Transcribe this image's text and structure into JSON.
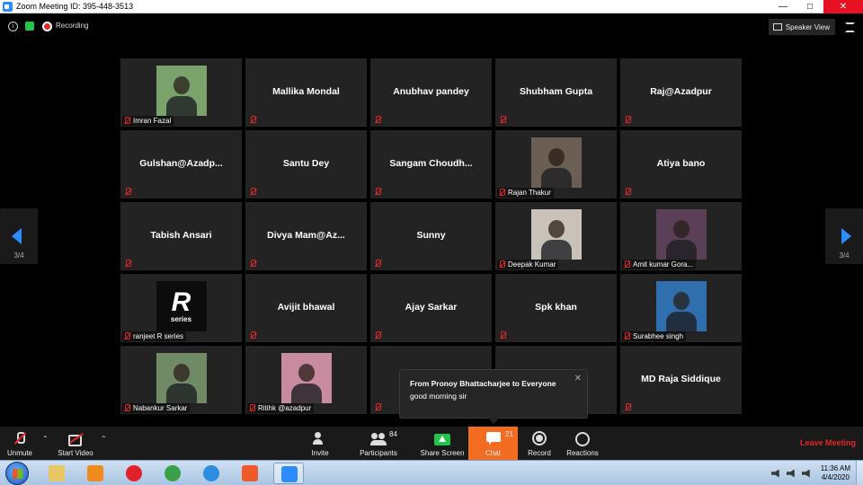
{
  "window": {
    "title": "Zoom Meeting ID: 395-448-3513"
  },
  "topbar": {
    "recording_label": "Recording",
    "speaker_view_label": "Speaker View"
  },
  "page_nav": {
    "indicator": "3/4"
  },
  "tiles": [
    {
      "display": "photo",
      "label": "Imran Fazal",
      "name": "",
      "photo_color": "#7aa36b"
    },
    {
      "display": "name",
      "name": "Mallika Mondal",
      "label": ""
    },
    {
      "display": "name",
      "name": "Anubhav pandey",
      "label": ""
    },
    {
      "display": "name",
      "name": "Shubham Gupta",
      "label": ""
    },
    {
      "display": "name",
      "name": "Raj@Azadpur",
      "label": ""
    },
    {
      "display": "name",
      "name": "Gulshan@Azadp...",
      "label": ""
    },
    {
      "display": "name",
      "name": "Santu Dey",
      "label": ""
    },
    {
      "display": "name",
      "name": "Sangam  Choudh...",
      "label": ""
    },
    {
      "display": "photo",
      "label": "Rajan Thakur",
      "name": "",
      "photo_color": "#6b5e52"
    },
    {
      "display": "name",
      "name": "Atiya bano",
      "label": ""
    },
    {
      "display": "name",
      "name": "Tabish Ansari",
      "label": ""
    },
    {
      "display": "name",
      "name": "Divya  Mam@Az...",
      "label": ""
    },
    {
      "display": "name",
      "name": "Sunny",
      "label": ""
    },
    {
      "display": "photo",
      "label": "Deepak Kumar",
      "name": "",
      "photo_color": "#c9c2b8"
    },
    {
      "display": "photo",
      "label": "Amit kumar Gora...",
      "name": "",
      "photo_color": "#5a3f57"
    },
    {
      "display": "photo",
      "label": "ranjeet R series",
      "name": "",
      "photo_color": "#0c0c0c",
      "logo_text": "R",
      "logo_sub": "series"
    },
    {
      "display": "name",
      "name": "Avijit bhawal",
      "label": ""
    },
    {
      "display": "name",
      "name": "Ajay Sarkar",
      "label": ""
    },
    {
      "display": "name",
      "name": "Spk khan",
      "label": ""
    },
    {
      "display": "photo",
      "label": "Surabhee singh",
      "name": "",
      "photo_color": "#2f6fae"
    },
    {
      "display": "photo",
      "label": "Nabankur Sarkar",
      "name": "",
      "photo_color": "#6f8a64"
    },
    {
      "display": "photo",
      "label": "Ritihk @azadpur",
      "name": "",
      "photo_color": "#c98ba0"
    },
    {
      "display": "name",
      "name": "",
      "label": ""
    },
    {
      "display": "name",
      "name": "",
      "label": ""
    },
    {
      "display": "name",
      "name": "MD Raja Siddique",
      "label": ""
    }
  ],
  "chat_popup": {
    "from": "From Pronoy Bhattacharjee to Everyone",
    "message": "good morning sir",
    "close": "✕"
  },
  "controls": {
    "unmute": "Unmute",
    "start_video": "Start Video",
    "invite": "Invite",
    "participants": "Participants",
    "participants_count": "84",
    "share_screen": "Share Screen",
    "chat": "Chat",
    "chat_count": "21",
    "record": "Record",
    "reactions": "Reactions",
    "leave": "Leave Meeting"
  },
  "taskbar": {
    "time": "11:36 AM",
    "date": "4/4/2020",
    "apps": [
      {
        "icon": "file-explorer-icon",
        "color": "#e8c766"
      },
      {
        "icon": "media-player-icon",
        "color": "#f08a1c"
      },
      {
        "icon": "opera-icon",
        "color": "#e0202a"
      },
      {
        "icon": "network-globe-icon",
        "color": "#3aa04a"
      },
      {
        "icon": "internet-explorer-icon",
        "color": "#2b8ee0"
      },
      {
        "icon": "brave-icon",
        "color": "#f05a28"
      },
      {
        "icon": "zoom-icon",
        "color": "#2d8cff"
      }
    ]
  },
  "colors": {
    "accent": "#2d8cff",
    "chat_active": "#f26d21",
    "leave": "#e02828",
    "mute": "#e02828"
  }
}
